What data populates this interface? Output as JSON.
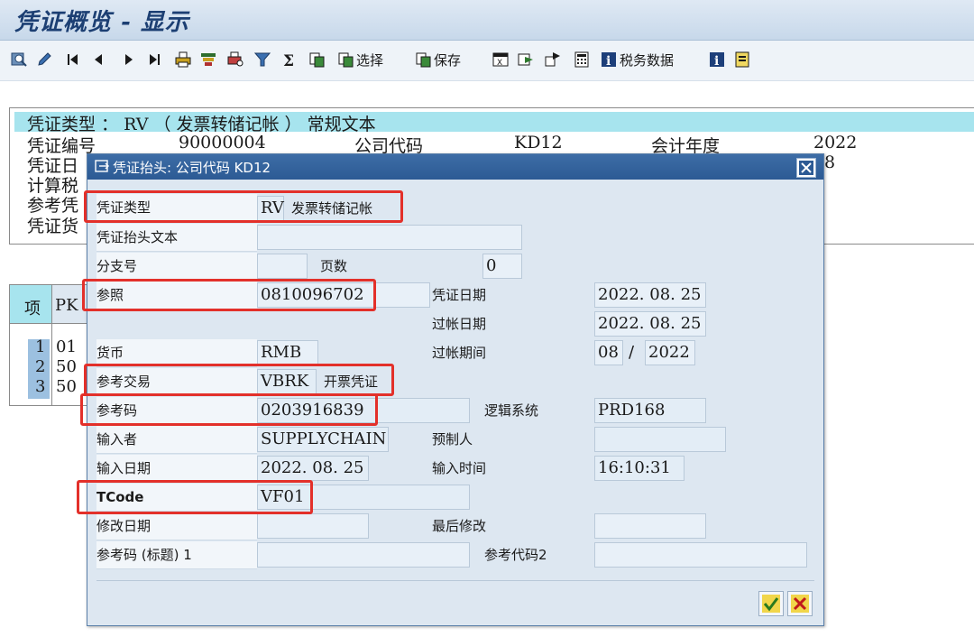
{
  "window": {
    "title": "凭证概览 - 显示"
  },
  "toolbar": {
    "select_label": "选择",
    "save_label": "保存",
    "tax_label": "税务数据"
  },
  "background": {
    "header_line": "凭证类型 ： RV （ 发票转储记帐 ） 常规文本",
    "doc_no_label": "凭证编号",
    "doc_no_value": "90000004",
    "company_code_label": "公司代码",
    "company_code_value": "KD12",
    "fiscal_year_label": "会计年度",
    "fiscal_year_value": "2022",
    "row3_label": "凭证日",
    "row3_value_tail": "8",
    "row4_label": "计算税",
    "row5_label": "参考凭",
    "row6_label": "凭证货",
    "items": {
      "col_item": "项",
      "col_pk": "PK",
      "rows": [
        {
          "item": "1",
          "pk": "01"
        },
        {
          "item": "2",
          "pk": "50"
        },
        {
          "item": "3",
          "pk": "50"
        }
      ]
    }
  },
  "dialog": {
    "title": "凭证抬头: 公司代码 KD12",
    "fields": {
      "doc_type_label": "凭证类型",
      "doc_type_value": "RV",
      "doc_type_desc": "发票转储记帐",
      "header_text_label": "凭证抬头文本",
      "header_text_value": "",
      "branch_label": "分支号",
      "branch_value": "",
      "pages_label": "页数",
      "pages_value": "0",
      "reference_label": "参照",
      "reference_value": "0810096702",
      "doc_date_label": "凭证日期",
      "doc_date_value": "2022. 08. 25",
      "posting_date_label": "过帐日期",
      "posting_date_value": "2022. 08. 25",
      "currency_label": "货币",
      "currency_value": "RMB",
      "period_label": "过帐期间",
      "period_value": "08",
      "period_sep": "/",
      "period_year": "2022",
      "ref_trans_label": "参考交易",
      "ref_trans_value": "VBRK",
      "ref_trans_desc": "开票凭证",
      "ref_key_label": "参考码",
      "ref_key_value": "0203916839",
      "logical_system_label": "逻辑系统",
      "logical_system_value": "PRD168",
      "entered_by_label": "输入者",
      "entered_by_value": "SUPPLYCHAIN",
      "parked_by_label": "预制人",
      "parked_by_value": "",
      "entry_date_label": "输入日期",
      "entry_date_value": "2022. 08. 25",
      "entry_time_label": "输入时间",
      "entry_time_value": "16:10:31",
      "tcode_label": "TCode",
      "tcode_value": "VF01",
      "changed_on_label": "修改日期",
      "changed_on_value": "",
      "last_change_label": "最后修改",
      "last_change_value": "",
      "ref_key_hdr1_label": "参考码 (标题) 1",
      "ref_key_hdr1_value": "",
      "ref_key2_label": "参考代码2",
      "ref_key2_value": ""
    }
  },
  "colors": {
    "highlight": "#e3302a",
    "title": "#1c3f73",
    "dialog_header": "#2c5a94"
  }
}
